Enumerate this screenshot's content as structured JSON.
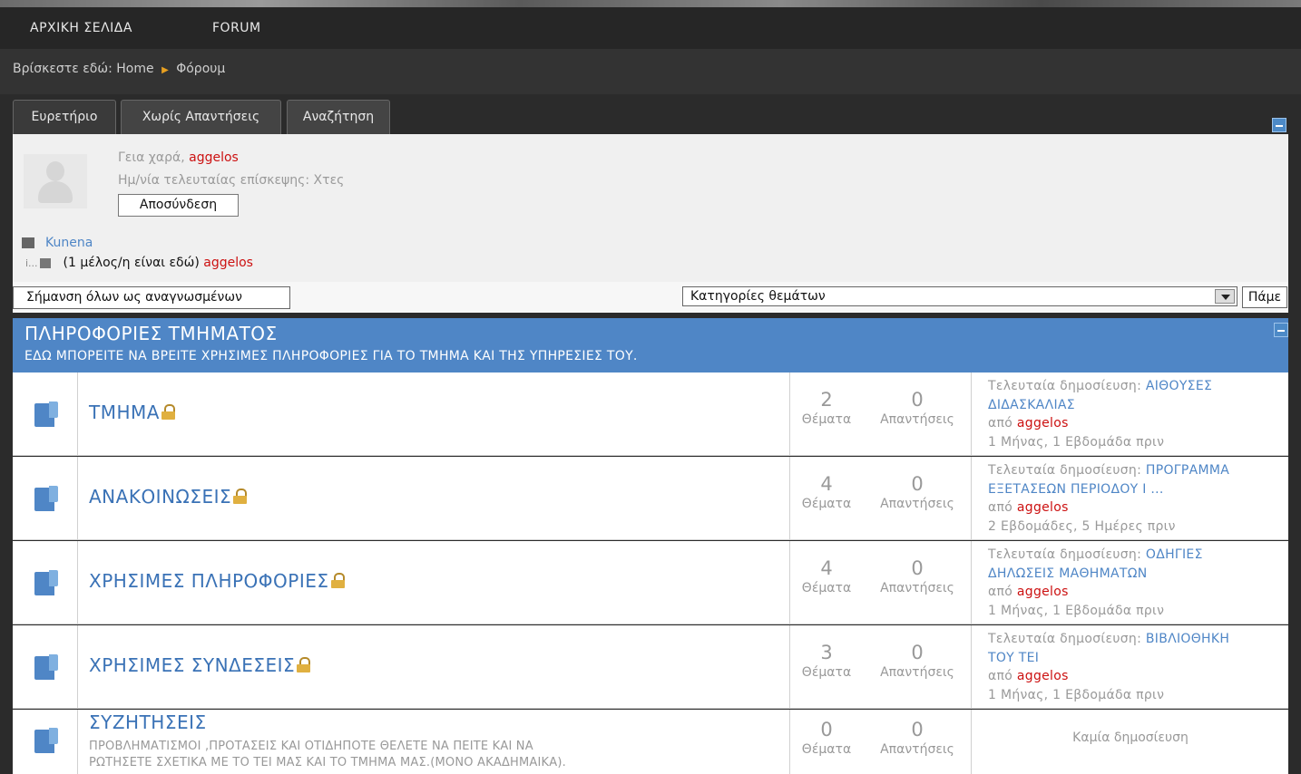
{
  "nav": {
    "home": "ΑΡΧΙΚΗ ΣΕΛΙΔΑ",
    "forum": "FORUM"
  },
  "breadcrumb": {
    "prefix": "Βρίσκεστε εδώ:",
    "home": "Home",
    "current": "Φόρουμ"
  },
  "tabs": [
    {
      "label": "Ευρετήριο"
    },
    {
      "label": "Χωρίς Απαντήσεις"
    },
    {
      "label": "Αναζήτηση"
    }
  ],
  "profile": {
    "greeting": "Γεια χαρά,",
    "username": "aggelos",
    "last_visit": "Ημ/νία τελευταίας επίσκεψης: Χτες",
    "logout_label": "Αποσύνδεση"
  },
  "stats": {
    "kunena": "Kunena",
    "members_online": "(1 μέλος/η είναι εδώ)",
    "member_name": "aggelos"
  },
  "actions": {
    "mark_read": "Σήμανση όλων ως αναγνωσμένων",
    "category_select": "Κατηγορίες θεμάτων",
    "go": "Πάμε"
  },
  "section": {
    "title": "ΠΛΗΡΟΦΟΡΙΕΣ ΤΜΗΜΑΤΟΣ",
    "description": "ΕΔΩ ΜΠΟΡΕΙΤΕ ΝΑ ΒΡΕΙΤΕ ΧΡΗΣΙΜΕΣ ΠΛΗΡΟΦΟΡΙΕΣ ΓΙΑ ΤΟ ΤΜΗΜΑ ΚΑΙ ΤΗΣ ΥΠΗΡΕΣΙΕΣ ΤΟΥ."
  },
  "labels": {
    "topics": "Θέματα",
    "replies": "Απαντήσεις",
    "last_post": "Τελευταία δημοσίευση:",
    "by": "από",
    "no_posts": "Καμία δημοσίευση"
  },
  "forums": [
    {
      "name": "ΤΜΗΜΑ",
      "topics": "2",
      "replies": "0",
      "last_title_1": "ΑΙΘΟΥΣΕΣ",
      "last_title_2": "ΔΙΔΑΣΚΑΛΙΑΣ",
      "author": "aggelos",
      "time": "1 Μήνας, 1 Εβδομάδα πριν"
    },
    {
      "name": "ΑΝΑΚΟΙΝΩΣΕΙΣ",
      "topics": "4",
      "replies": "0",
      "last_title_1": "ΠΡΟΓΡΑΜΜΑ",
      "last_title_2": "ΕΞΕΤΑΣΕΩΝ ΠΕΡΙΟΔΟΥ Ι ...",
      "author": "aggelos",
      "time": "2 Εβδομάδες, 5 Ημέρες πριν"
    },
    {
      "name": "ΧΡΗΣΙΜΕΣ ΠΛΗΡΟΦΟΡΙΕΣ",
      "topics": "4",
      "replies": "0",
      "last_title_1": "ΟΔΗΓΙΕΣ",
      "last_title_2": "ΔΗΛΩΣΕΙΣ ΜΑΘΗΜΑΤΩΝ",
      "author": "aggelos",
      "time": "1 Μήνας, 1 Εβδομάδα πριν"
    },
    {
      "name": "ΧΡΗΣΙΜΕΣ ΣΥΝΔΕΣΕΙΣ",
      "topics": "3",
      "replies": "0",
      "last_title_1": "ΒΙΒΛΙΟΘΗΚΗ",
      "last_title_2": "ΤΟΥ ΤΕΙ",
      "author": "aggelos",
      "time": "1 Μήνας, 1 Εβδομάδα πριν"
    },
    {
      "name": "ΣΥΖΗΤΗΣΕΙΣ",
      "description_1": "ΠΡΟΒΛΗΜΑΤΙΣΜΟΙ ,ΠΡΟΤΑΣΕΙΣ ΚΑΙ ΟΤΙΔΗΠΟΤΕ ΘΕΛΕΤΕ ΝΑ ΠΕΙΤΕ ΚΑΙ ΝΑ",
      "description_2": "ΡΩΤΗΣΕΤΕ ΣΧΕΤΙΚΑ ΜΕ ΤΟ ΤΕΙ ΜΑΣ ΚΑΙ ΤΟ ΤΜΗΜΑ ΜΑΣ.(ΜΟΝΟ ΑΚΑΔΗΜΑΙΚΑ).",
      "topics": "0",
      "replies": "0"
    }
  ]
}
